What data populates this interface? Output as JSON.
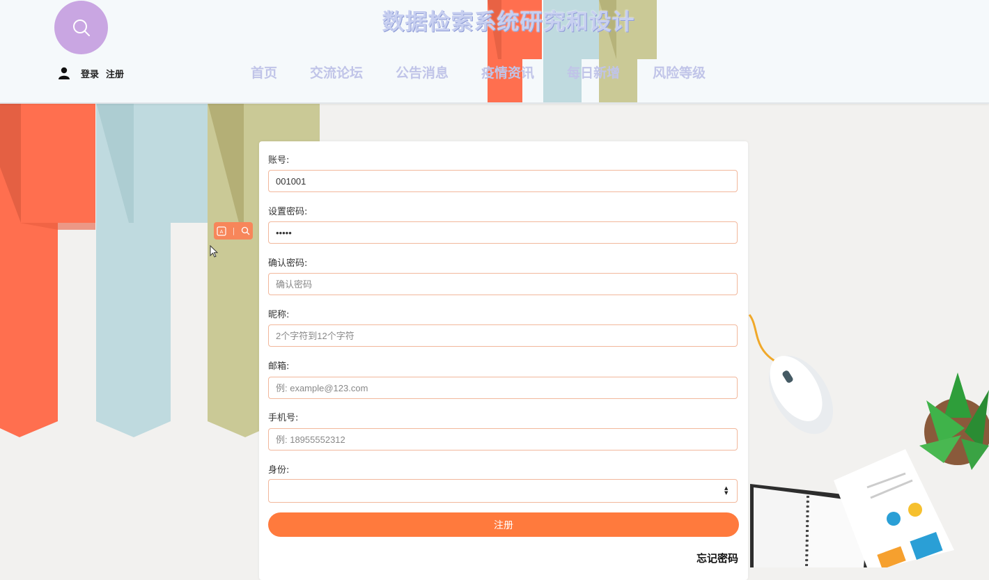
{
  "header": {
    "title": "数据检索系统研究和设计",
    "user_links": {
      "login": "登录",
      "register": "注册"
    },
    "nav": [
      "首页",
      "交流论坛",
      "公告消息",
      "疫情资讯",
      "每日新增",
      "风险等级"
    ]
  },
  "form": {
    "fields": [
      {
        "label": "账号:",
        "value": "001001",
        "placeholder": ""
      },
      {
        "label": "设置密码:",
        "value": "•••••",
        "placeholder": ""
      },
      {
        "label": "确认密码:",
        "value": "",
        "placeholder": "确认密码"
      },
      {
        "label": "昵称:",
        "value": "",
        "placeholder": "2个字符到12个字符"
      },
      {
        "label": "邮箱:",
        "value": "",
        "placeholder": "例: example@123.com"
      },
      {
        "label": "手机号:",
        "value": "",
        "placeholder": "例: 18955552312"
      }
    ],
    "role": {
      "label": "身份:",
      "selected": ""
    },
    "submit_label": "注册",
    "forgot_label": "忘记密码"
  },
  "icons": {
    "logo": "search-icon",
    "user": "user-icon",
    "select_arrows": "updown-arrows-icon",
    "float_tools": [
      "translate-icon",
      "search-icon"
    ]
  },
  "colors": {
    "accent": "#ff7a3d",
    "input_border": "#f2b79b",
    "logo_bg": "#c9a6e2",
    "nav_text": "#c0c4e8",
    "ribbon_red": "#ff6f4f",
    "ribbon_blue": "#bfdadf",
    "ribbon_olive": "#cac996"
  }
}
